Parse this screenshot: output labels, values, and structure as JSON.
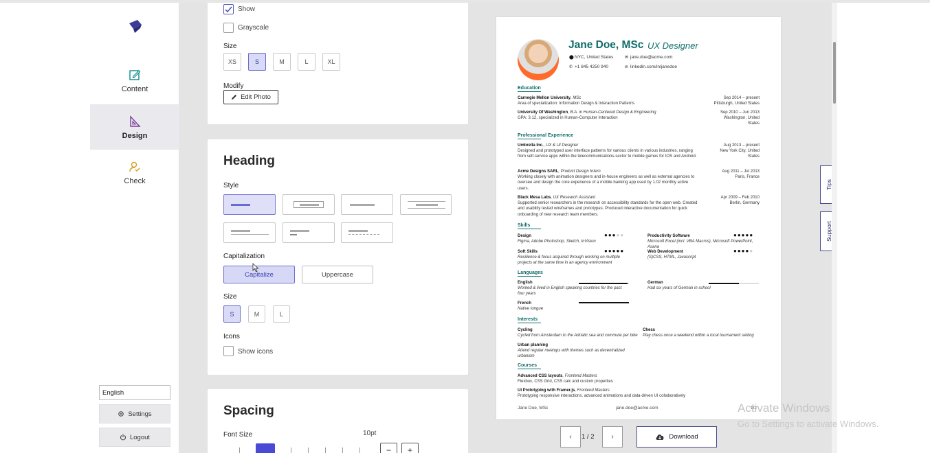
{
  "sidebar": {
    "items": [
      {
        "label": "Content",
        "icon": "edit-icon"
      },
      {
        "label": "Design",
        "icon": "ruler-triangle-icon"
      },
      {
        "label": "Check",
        "icon": "user-check-icon"
      }
    ],
    "language": "English",
    "settings_label": "Settings",
    "logout_label": "Logout"
  },
  "photo": {
    "show_label": "Show",
    "grayscale_label": "Grayscale",
    "size_label": "Size",
    "sizes": [
      "XS",
      "S",
      "M",
      "L",
      "XL"
    ],
    "modify_label": "Modify",
    "edit_label": "Edit Photo"
  },
  "heading": {
    "title": "Heading",
    "style_label": "Style",
    "capitalization_label": "Capitalization",
    "capitalize_label": "Capitalize",
    "uppercase_label": "Uppercase",
    "size_label": "Size",
    "sizes": [
      "S",
      "M",
      "L"
    ],
    "icons_label": "Icons",
    "show_icons_label": "Show icons"
  },
  "spacing": {
    "title": "Spacing",
    "font_size_label": "Font Size",
    "font_size_value": "10pt",
    "minus": "−",
    "plus": "+"
  },
  "resume": {
    "name": "Jane Doe, MSc",
    "role": "UX Designer",
    "location": "NYC, United States",
    "email": "jane.doe@acme.com",
    "phone": "+1 845 4250 940",
    "linkedin": "linkedin.com/in/janedoe",
    "sections": {
      "education": "Education",
      "experience": "Professional Experience",
      "skills": "Skills",
      "languages": "Languages",
      "interests": "Interests",
      "courses": "Courses"
    },
    "education": [
      {
        "school": "Carnegie Mellon University",
        "degree": ", MSc",
        "detail": "Area of specialization: Information Design & Interaction Patterns",
        "date": "Sep 2014 – present",
        "place": "Pittsburgh, United States"
      },
      {
        "school": "University Of Washington",
        "degree": ", B.A. in Human-Centered Design & Engineering",
        "detail": "GPA: 3.12, specialized in Human-Computer Interaction",
        "date": "Sep 2010 – Jun 2013",
        "place": "Washington, United States"
      }
    ],
    "experience": [
      {
        "company": "Umbrella Inc.",
        "title": ", UX & UI Designer",
        "desc": "Designed and prototyped user interface patterns for various clients in various industries, ranging from self-service apps within the telecommunications-sector to mobile games for IOS and Android.",
        "date": "Aug 2013 – present",
        "place": "New York City, United States"
      },
      {
        "company": "Acme Designs SARL",
        "title": ", Product Design Intern",
        "desc": "Working closely with animation designers and in-house engineers as well as external agencies to oversee and design the core experience of a mobile banking app used by 1.02 monthly active users.",
        "date": "Aug 2011 – Jul 2013",
        "place": "Paris, France"
      },
      {
        "company": "Black Mesa Labs",
        "title": ", UX Research Assistant",
        "desc": "Supported senior researchers in the research on accessibility standards for the open web. Created and usability tested wireframes and prototypes. Produced interactive documentation for quick onboarding of new research team members.",
        "date": "Apr 2009 – Feb 2010",
        "place": "Berlin, Germany"
      }
    ],
    "skills": [
      {
        "name": "Design",
        "desc": "Figma, Adobe Photoshop, Sketch, InVision",
        "level": 3
      },
      {
        "name": "Productivity Software",
        "desc": "Microsoft Excel (incl. VBA Macros), Microsoft PowerPoint, Asana",
        "level": 5
      },
      {
        "name": "Soft Skills",
        "desc": "Resilience & focus acquired through working on multiple projects at the same time in an agency environment",
        "level": 5
      },
      {
        "name": "Web Development",
        "desc": "(S)CSS, HTML, Javascript",
        "level": 4
      }
    ],
    "languages": [
      {
        "name": "English",
        "desc": "Worked & lived in English speaking countries for the past four years",
        "level": 0.97
      },
      {
        "name": "German",
        "desc": "Had six years of German in school",
        "level": 0.6
      },
      {
        "name": "French",
        "desc": "Native tongue",
        "level": 1.0
      }
    ],
    "interests": [
      {
        "name": "Cycling",
        "desc": "Cycled from Amsterdam to the Adriatic sea and commute per bike"
      },
      {
        "name": "Chess",
        "desc": "Play chess once a weekend within a local tournament setting"
      },
      {
        "name": "Urban planning",
        "desc": "Attend regular meetups with themes such as decentralized urbanism"
      }
    ],
    "courses": [
      {
        "name": "Advanced CSS layouts",
        "provider": ", Frontend Masters",
        "desc": "Flexbox, CSS Grid, CSS calc and custom properties"
      },
      {
        "name": "UI Prototyping with Framer.js",
        "provider": ", Frontend Masters",
        "desc": "Prototyping responsive interactions, advanced animations and data-driven UI collaboratively"
      }
    ],
    "footer_name": "Jane Doe, MSc",
    "footer_email": "jane.doe@acme.com",
    "footer_page": "1/2"
  },
  "pager": {
    "prev": "‹",
    "page": "1 / 2",
    "next": "›"
  },
  "download_label": "Download",
  "tabs": {
    "tips": "Tips",
    "support": "Support"
  },
  "windows": {
    "line1": "Activate Windows",
    "line2": "Go to Settings to activate Windows."
  },
  "colors": {
    "accent": "#4a4ad6",
    "resume_teal": "#0e6d6a"
  }
}
